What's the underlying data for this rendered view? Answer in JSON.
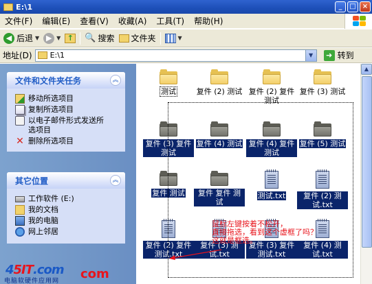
{
  "window": {
    "title": "E:\\1"
  },
  "menu": [
    "文件(F)",
    "编辑(E)",
    "查看(V)",
    "收藏(A)",
    "工具(T)",
    "帮助(H)"
  ],
  "toolbar": {
    "back": "后退",
    "search": "搜索",
    "folders": "文件夹"
  },
  "address": {
    "label": "地址(D)",
    "value": "E:\\1",
    "go": "转到"
  },
  "tasks_panel": {
    "title": "文件和文件夹任务",
    "items": [
      "移动所选项目",
      "复制所选项目",
      "以电子邮件形式发送所选项目",
      "删除所选项目"
    ]
  },
  "places_panel": {
    "title": "其它位置",
    "items": [
      "工作软件 (E:)",
      "我的文档",
      "我的电脑",
      "网上邻居"
    ]
  },
  "files": [
    {
      "name": "测试",
      "icon": "folder-yellow",
      "selected": false,
      "focus": true
    },
    {
      "name": "复件 (2) 测试",
      "icon": "folder-yellow",
      "selected": false
    },
    {
      "name": "复件 (2) 复件 测试",
      "icon": "folder-yellow",
      "selected": false
    },
    {
      "name": "复件 (3) 测试",
      "icon": "folder-yellow",
      "selected": false
    },
    {
      "name": "复件 (3) 复件 测试",
      "icon": "folder-grey",
      "selected": true
    },
    {
      "name": "复件 (4) 测试",
      "icon": "folder-grey",
      "selected": true
    },
    {
      "name": "复件 (4) 复件 测试",
      "icon": "folder-grey",
      "selected": true
    },
    {
      "name": "复件 (5) 测试",
      "icon": "folder-grey",
      "selected": true
    },
    {
      "name": "复件 测试",
      "icon": "folder-grey",
      "selected": true
    },
    {
      "name": "复件 复件 测试",
      "icon": "folder-grey",
      "selected": true
    },
    {
      "name": "测试.txt",
      "icon": "text-file",
      "selected": true
    },
    {
      "name": "复件 (2) 测试.txt",
      "icon": "text-file",
      "selected": true
    },
    {
      "name": "复件 (2) 复件 测试.txt",
      "icon": "text-file",
      "selected": true
    },
    {
      "name": "复件 (3) 测试.txt",
      "icon": "text-file",
      "selected": true
    },
    {
      "name": "复件 (3) 复件 测试.txt",
      "icon": "text-file",
      "selected": true
    },
    {
      "name": "复件 (4) 测试.txt",
      "icon": "text-file",
      "selected": true
    }
  ],
  "annotation": {
    "lines": [
      "鼠标左键按着不松开，",
      "直接拖选，看到这个虚框了吗？",
      "这就是框选。"
    ],
    "color": "#e8141c"
  },
  "watermark": {
    "logo_a": "4",
    "logo_b": "5IT",
    "logo_c": ".com",
    "sub": "电脑软硬件应用网",
    "com": "com"
  },
  "colors": {
    "title_bar": "#1d4fb8",
    "selection": "#0a246a",
    "task_pane": "#7da2ce",
    "panel_header_text": "#215dc6"
  }
}
